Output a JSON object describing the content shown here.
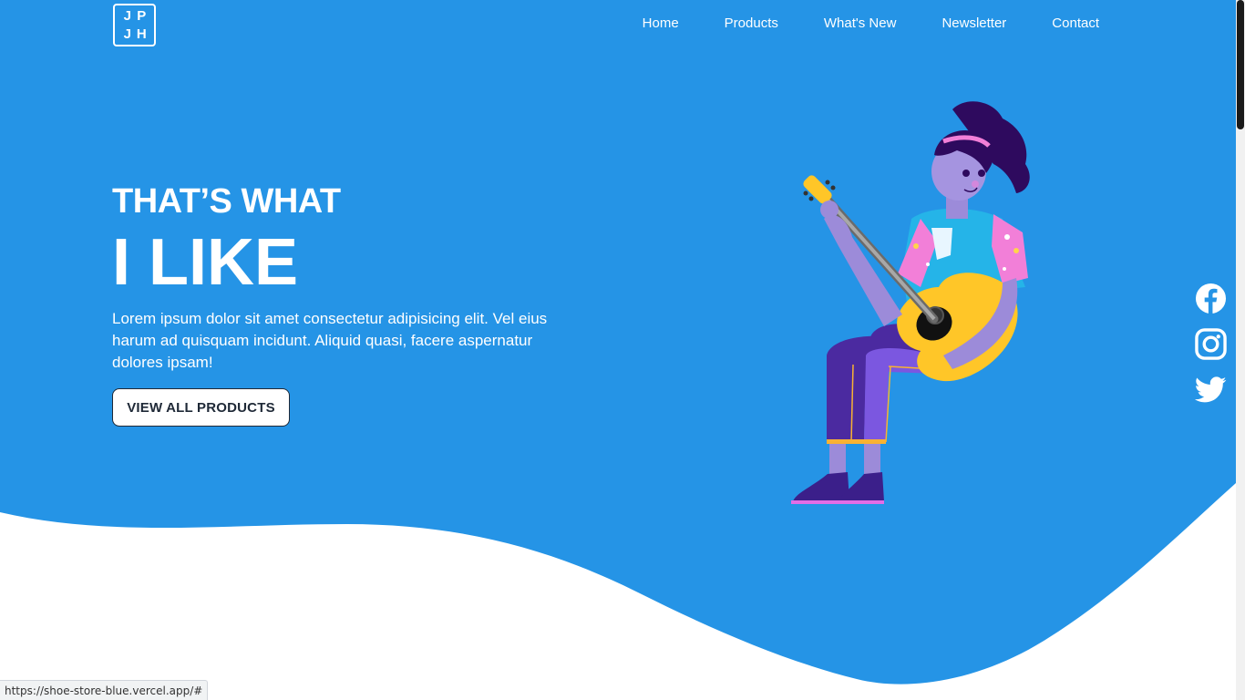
{
  "brand": {
    "logo_letters": [
      "J",
      "P",
      "J",
      "H"
    ]
  },
  "nav": {
    "items": [
      {
        "label": "Home"
      },
      {
        "label": "Products"
      },
      {
        "label": "What's New"
      },
      {
        "label": "Newsletter"
      },
      {
        "label": "Contact"
      }
    ]
  },
  "hero": {
    "heading_small": "THAT’S WHAT",
    "heading_big": "I LIKE",
    "description": "Lorem ipsum dolor sit amet consectetur adipisicing elit. Vel eius harum ad quisquam incidunt. Aliquid quasi, facere aspernatur dolores ipsam!",
    "cta_label": "VIEW ALL PRODUCTS"
  },
  "social": {
    "icons": [
      "facebook-icon",
      "instagram-icon",
      "twitter-icon"
    ]
  },
  "status_bar": {
    "url": "https://shoe-store-blue.vercel.app/#"
  },
  "colors": {
    "primary": "#2594E6",
    "background": "#FFFFFF",
    "text_dark": "#1F2937"
  }
}
